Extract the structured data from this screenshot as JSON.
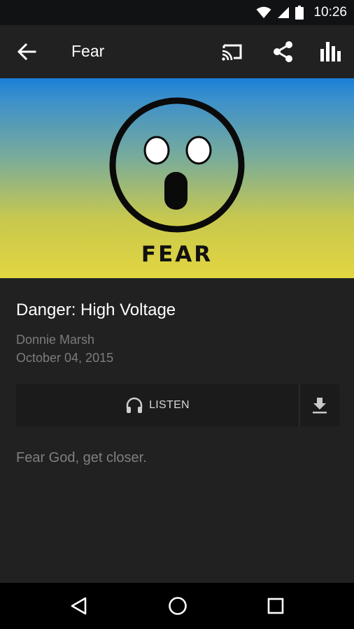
{
  "status_bar": {
    "time": "10:26",
    "icons": [
      "wifi-icon",
      "cell-signal-icon",
      "battery-icon"
    ]
  },
  "app_bar": {
    "title": "Fear",
    "icons": [
      "back-arrow-icon",
      "cast-icon",
      "share-icon",
      "equalizer-icon"
    ]
  },
  "artwork": {
    "label": "FEAR",
    "icon": "shocked-face-icon",
    "colors": {
      "top": "#1a7fd8",
      "bottom": "#e3d640"
    }
  },
  "episode": {
    "title": "Danger: High Voltage",
    "author": "Donnie Marsh",
    "date": "October 04, 2015"
  },
  "actions": {
    "listen_label": "LISTEN",
    "listen_icon": "headphones-icon",
    "download_icon": "download-icon"
  },
  "description": "Fear God, get closer.",
  "nav_bar": {
    "icons": [
      "back-triangle-icon",
      "home-circle-icon",
      "recents-square-icon"
    ]
  }
}
